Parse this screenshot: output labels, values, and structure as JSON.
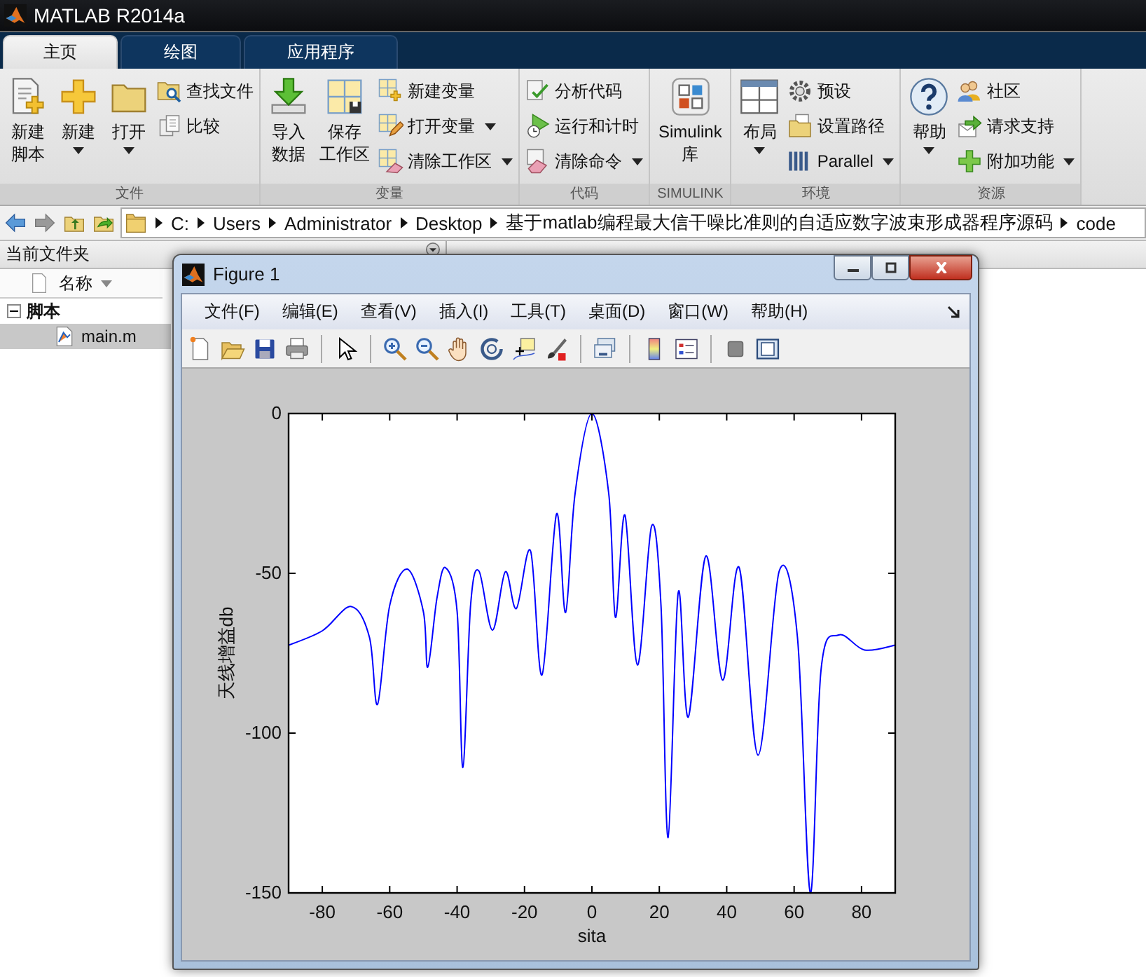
{
  "app": {
    "title": "MATLAB R2014a"
  },
  "tabs": [
    {
      "label": "主页",
      "selected": true
    },
    {
      "label": "绘图",
      "selected": false
    },
    {
      "label": "应用程序",
      "selected": false
    }
  ],
  "ribbon": [
    {
      "title": "文件",
      "items": [
        {
          "kind": "large",
          "lines": [
            "新建",
            "脚本"
          ],
          "dropdown": false
        },
        {
          "kind": "large",
          "lines": [
            "新建"
          ],
          "dropdown": true
        },
        {
          "kind": "large",
          "lines": [
            "打开"
          ],
          "dropdown": true
        },
        {
          "kind": "stack",
          "items": [
            {
              "label": "查找文件",
              "dropdown": false
            },
            {
              "label": "比较",
              "dropdown": false
            }
          ]
        }
      ]
    },
    {
      "title": "变量",
      "items": [
        {
          "kind": "large",
          "lines": [
            "导入",
            "数据"
          ],
          "dropdown": false
        },
        {
          "kind": "large",
          "lines": [
            "保存",
            "工作区"
          ],
          "dropdown": false
        },
        {
          "kind": "stack",
          "items": [
            {
              "label": "新建变量",
              "dropdown": false
            },
            {
              "label": "打开变量",
              "dropdown": true
            },
            {
              "label": "清除工作区",
              "dropdown": true
            }
          ]
        }
      ]
    },
    {
      "title": "代码",
      "items": [
        {
          "kind": "stack",
          "items": [
            {
              "label": "分析代码",
              "dropdown": false
            },
            {
              "label": "运行和计时",
              "dropdown": false
            },
            {
              "label": "清除命令",
              "dropdown": true
            }
          ]
        }
      ]
    },
    {
      "title": "SIMULINK",
      "items": [
        {
          "kind": "large",
          "lines": [
            "Simulink",
            "库"
          ],
          "dropdown": false
        }
      ]
    },
    {
      "title": "环境",
      "items": [
        {
          "kind": "large",
          "lines": [
            "布局"
          ],
          "dropdown": true
        },
        {
          "kind": "stack",
          "items": [
            {
              "label": "预设",
              "dropdown": false
            },
            {
              "label": "设置路径",
              "dropdown": false
            },
            {
              "label": "Parallel",
              "dropdown": true
            }
          ]
        }
      ]
    },
    {
      "title": "资源",
      "items": [
        {
          "kind": "large",
          "lines": [
            "帮助"
          ],
          "dropdown": true
        },
        {
          "kind": "stack",
          "items": [
            {
              "label": "社区",
              "dropdown": false
            },
            {
              "label": "请求支持",
              "dropdown": false
            },
            {
              "label": "附加功能",
              "dropdown": true
            }
          ]
        }
      ]
    }
  ],
  "address": {
    "path": [
      "C:",
      "Users",
      "Administrator",
      "Desktop",
      "基于matlab编程最大信干噪比准则的自适应数字波束形成器程序源码",
      "code"
    ]
  },
  "current_folder": {
    "title": "当前文件夹",
    "column": "名称",
    "tree": [
      {
        "label": "脚本",
        "expanded": true,
        "children": [
          {
            "label": "main.m",
            "selected": true
          }
        ]
      }
    ]
  },
  "figure": {
    "title": "Figure 1",
    "menu": [
      "文件(F)",
      "编辑(E)",
      "查看(V)",
      "插入(I)",
      "工具(T)",
      "桌面(D)",
      "窗口(W)",
      "帮助(H)"
    ],
    "chart_data": {
      "type": "line",
      "xlabel": "sita",
      "ylabel": "天线增益db",
      "xlim": [
        -90,
        90
      ],
      "ylim": [
        -150,
        0
      ],
      "xticks": [
        -80,
        -60,
        -40,
        -20,
        0,
        20,
        40,
        60,
        80
      ],
      "yticks": [
        -150,
        -100,
        -50,
        0
      ],
      "x": [
        -90,
        -80,
        -71.4,
        -66,
        -63.6,
        -60,
        -54.8,
        -50,
        -48.7,
        -46,
        -43.5,
        -40,
        -38.3,
        -36,
        -33.5,
        -29.5,
        -25.7,
        -22.4,
        -18.2,
        -14.8,
        -10.5,
        -7.8,
        -5,
        0,
        5,
        7,
        9.8,
        13.5,
        17.7,
        20.5,
        22.6,
        25.6,
        28.6,
        33.8,
        38.8,
        43.7,
        49.3,
        55.6,
        61,
        64.8,
        68,
        73.2,
        80.9,
        90
      ],
      "values": [
        -72.5,
        -68,
        -60.4,
        -70,
        -91,
        -60,
        -48.7,
        -62,
        -79.4,
        -58,
        -48.2,
        -62,
        -110.8,
        -60,
        -49.3,
        -67.8,
        -49.5,
        -61,
        -43,
        -81.8,
        -31.5,
        -62.3,
        -25,
        0,
        -25,
        -63.8,
        -31.8,
        -78.7,
        -35.2,
        -60,
        -132.7,
        -56,
        -95,
        -44.6,
        -83.4,
        -48.2,
        -106.9,
        -49.3,
        -70,
        -150,
        -80,
        -69.3,
        -74,
        -72.5
      ]
    }
  }
}
